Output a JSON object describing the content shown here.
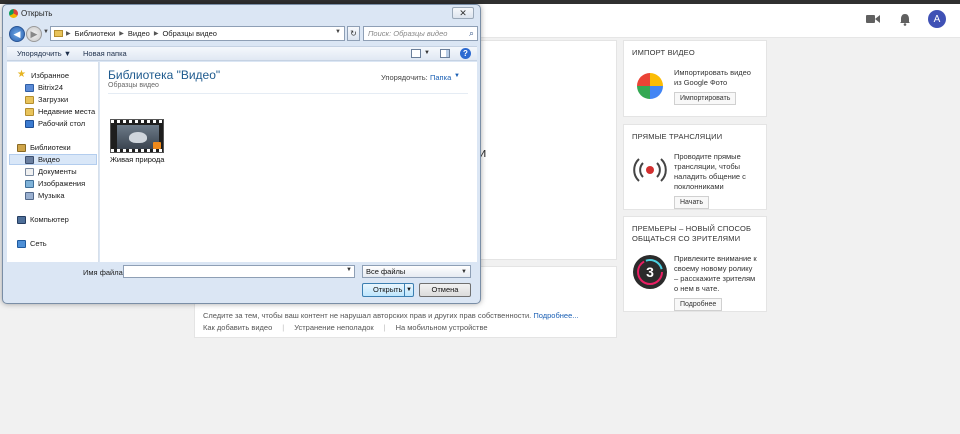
{
  "youtube": {
    "avatar_letter": "A",
    "main_partial_text": "и",
    "notice_more_line": "Следите за тем, чтобы ваш контент не нарушал авторских прав и других прав собственности.",
    "notice_more_link": "Подробнее...",
    "footer_links": [
      "Как добавить видео",
      "Устранение неполадок",
      "На мобильном устройстве"
    ],
    "side_cards": [
      {
        "title": "ИМПОРТ ВИДЕО",
        "description": "Импортировать видео из Google Фото",
        "button": "Импортировать",
        "icon": "google-photos-icon"
      },
      {
        "title": "ПРЯМЫЕ ТРАНСЛЯЦИИ",
        "description": "Проводите прямые трансляции, чтобы наладить общение с поклонниками",
        "button": "Начать",
        "icon": "live-broadcast-icon"
      },
      {
        "title": "ПРЕМЬЕРЫ – НОВЫЙ СПОСОБ ОБЩАТЬСЯ СО ЗРИТЕЛЯМИ",
        "description": "Привлеките внимание к своему новому ролику – расскажите зрителям о нем в чате.",
        "button": "Подробнее",
        "icon": "premiere-countdown-icon"
      }
    ],
    "premiere_number": "3"
  },
  "dialog": {
    "title": "Открыть",
    "close": "✕",
    "breadcrumbs": [
      "Библиотеки",
      "Видео",
      "Образцы видео"
    ],
    "search_placeholder": "Поиск: Образцы видео",
    "toolbar": {
      "organize": "Упорядочить ▼",
      "new_folder": "Новая папка"
    },
    "nav": {
      "favorites": "Избранное",
      "fav_items": [
        "Bitrix24",
        "Загрузки",
        "Недавние места",
        "Рабочий стол"
      ],
      "libraries": "Библиотеки",
      "lib_items": [
        "Видео",
        "Документы",
        "Изображения",
        "Музыка"
      ],
      "computer": "Компьютер",
      "network": "Сеть"
    },
    "library_title": "Библиотека \"Видео\"",
    "library_subtitle": "Образцы видео",
    "arrange_label": "Упорядочить:",
    "arrange_value": "Папка",
    "files": [
      "Живая природа"
    ],
    "file_name_label": "Имя файла:",
    "file_name_value": "",
    "file_type": "Все файлы",
    "open_button": "Открыть",
    "cancel_button": "Отмена"
  }
}
